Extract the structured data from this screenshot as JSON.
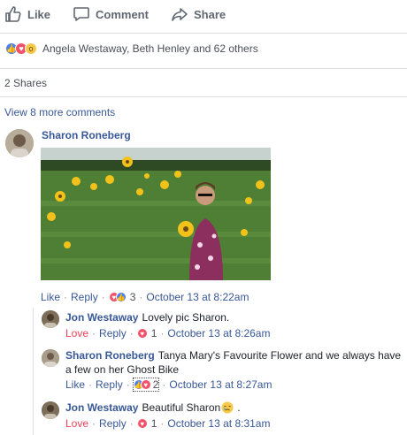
{
  "action_bar": {
    "like": "Like",
    "comment": "Comment",
    "share": "Share"
  },
  "reactions": {
    "names": "Angela Westaway, Beth Henley and 62 others"
  },
  "shares": "2 Shares",
  "view_more": "View 8 more comments",
  "comment_main": {
    "author": "Sharon Roneberg",
    "like": "Like",
    "reply": "Reply",
    "reaction_count": "3",
    "timestamp": "October 13 at 8:22am"
  },
  "replies": [
    {
      "author": "Jon Westaway",
      "text": "Lovely pic Sharon.",
      "action": "Love",
      "reply": "Reply",
      "reaction_count": "1",
      "timestamp": "October 13 at 8:26am"
    },
    {
      "author": "Sharon Roneberg",
      "text_line1": "Tanya Mary's Favourite Flower and we always have",
      "text_line2": "a few on her Ghost Bike",
      "action": "Like",
      "reply": "Reply",
      "reaction_count": "2",
      "timestamp": "October 13 at 8:27am"
    },
    {
      "author": "Jon Westaway",
      "text": "Beautiful Sharon",
      "action": "Love",
      "reply": "Reply",
      "reaction_count": "1",
      "timestamp": "October 13 at 8:31am"
    }
  ],
  "colors": {
    "link": "#385898",
    "love": "#f33e58",
    "muted": "#606770"
  }
}
